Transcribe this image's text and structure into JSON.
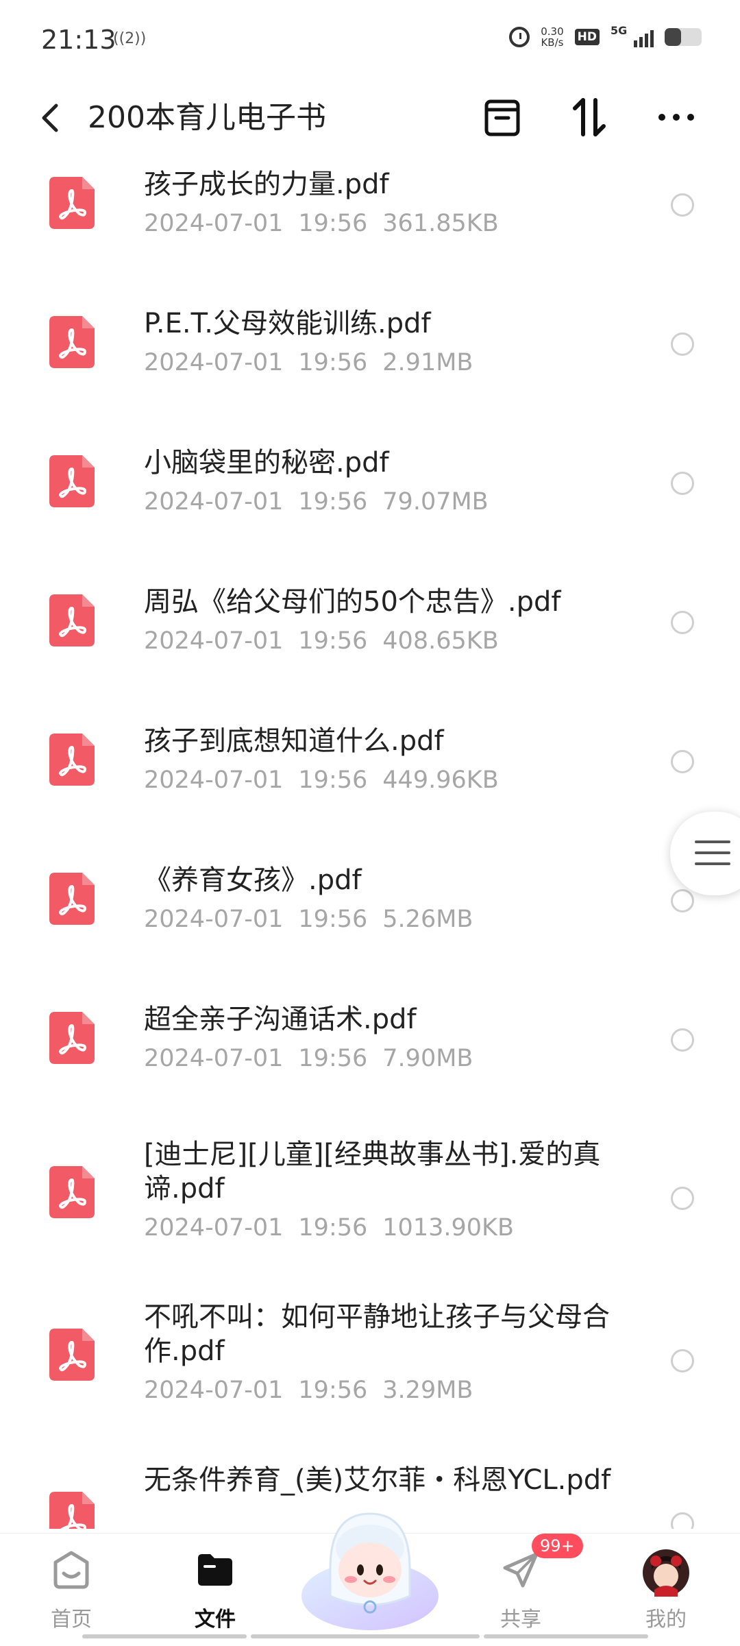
{
  "status_bar": {
    "time": "21:13",
    "hotspot": "((2))",
    "net_speed_value": "0.30",
    "net_speed_unit": "KB/s",
    "hd": "HD",
    "network": "5G",
    "battery_level": 0.45
  },
  "header": {
    "title": "200本育儿电子书",
    "back_icon": "chevron-left-icon",
    "archive_icon": "archive-box-icon",
    "sort_icon": "sort-arrows-icon",
    "more_icon": "more-dots-icon"
  },
  "files": [
    {
      "name": "孩子成长的力量.pdf",
      "date": "2024-07-01",
      "time": "19:56",
      "size": "361.85KB"
    },
    {
      "name": "P.E.T.父母效能训练.pdf",
      "date": "2024-07-01",
      "time": "19:56",
      "size": "2.91MB"
    },
    {
      "name": "小脑袋里的秘密.pdf",
      "date": "2024-07-01",
      "time": "19:56",
      "size": "79.07MB"
    },
    {
      "name": "周弘《给父母们的50个忠告》.pdf",
      "date": "2024-07-01",
      "time": "19:56",
      "size": "408.65KB"
    },
    {
      "name": "孩子到底想知道什么.pdf",
      "date": "2024-07-01",
      "time": "19:56",
      "size": "449.96KB"
    },
    {
      "name": "《养育女孩》.pdf",
      "date": "2024-07-01",
      "time": "19:56",
      "size": "5.26MB"
    },
    {
      "name": "超全亲子沟通话术.pdf",
      "date": "2024-07-01",
      "time": "19:56",
      "size": "7.90MB"
    },
    {
      "name": "[迪士尼][儿童][经典故事丛书].爱的真谛.pdf",
      "date": "2024-07-01",
      "time": "19:56",
      "size": "1013.90KB"
    },
    {
      "name": "不吼不叫：如何平静地让孩子与父母合作.pdf",
      "date": "2024-07-01",
      "time": "19:56",
      "size": "3.29MB"
    },
    {
      "name": "无条件养育_(美)艾尔菲・科恩YCL.pdf",
      "date": "",
      "time": "",
      "size": ""
    }
  ],
  "bottom_nav": {
    "items": [
      {
        "label": "首页",
        "icon": "home-smile-icon"
      },
      {
        "label": "文件",
        "icon": "folder-icon"
      },
      {
        "label": "",
        "icon": "mascot-icon"
      },
      {
        "label": "共享",
        "icon": "send-plane-icon"
      },
      {
        "label": "我的",
        "icon": "avatar-icon"
      }
    ],
    "share_badge": "99+"
  },
  "colors": {
    "pdf_red": "#f25a65",
    "meta_gray": "#a6a6a6",
    "badge_red": "#ff4d5e"
  }
}
